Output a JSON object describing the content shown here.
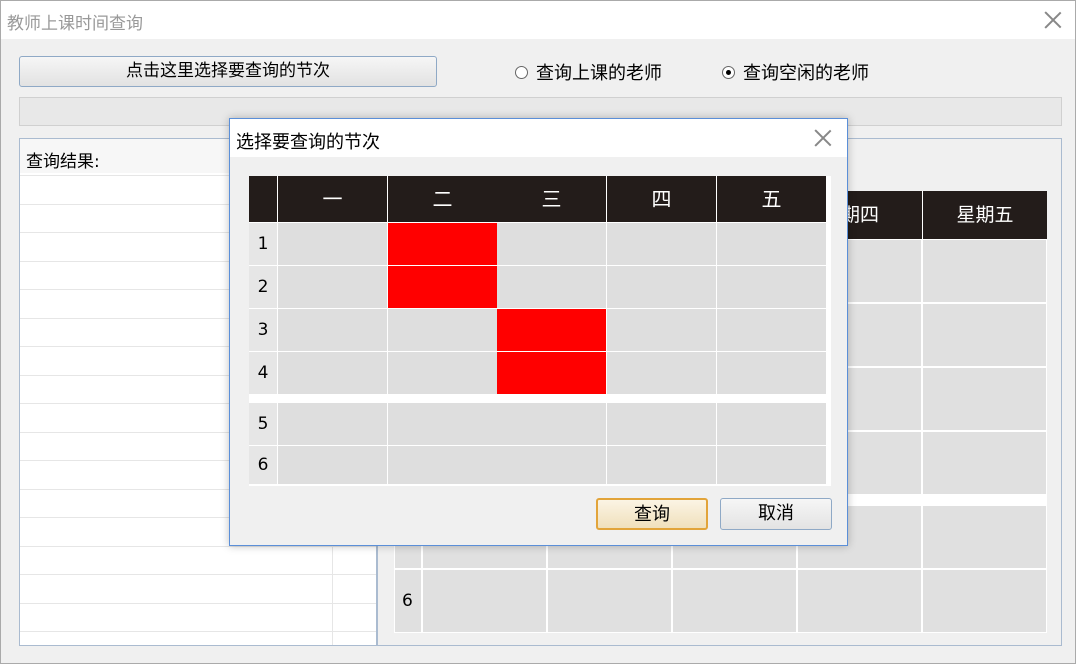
{
  "window": {
    "title": "教师上课时间查询"
  },
  "toolbar": {
    "select_button": "点击这里选择要查询的节次",
    "radio_busy": "查询上课的老师",
    "radio_free": "查询空闲的老师",
    "selected_radio": "free"
  },
  "results": {
    "header": "查询结果:"
  },
  "background_table": {
    "headers": [
      "期四",
      "星期五"
    ],
    "row_label_6": "6"
  },
  "dialog": {
    "title": "选择要查询的节次",
    "day_headers": [
      "一",
      "二",
      "三",
      "四",
      "五"
    ],
    "period_labels": [
      "1",
      "2",
      "3",
      "4",
      "5",
      "6"
    ],
    "selected": [
      [
        2,
        1
      ],
      [
        2,
        2
      ],
      [
        3,
        3
      ],
      [
        3,
        4
      ]
    ],
    "query_button": "查询",
    "cancel_button": "取消",
    "colors": {
      "selected": "#ff0000",
      "header": "#231c1a",
      "cell": "#dedede"
    }
  }
}
